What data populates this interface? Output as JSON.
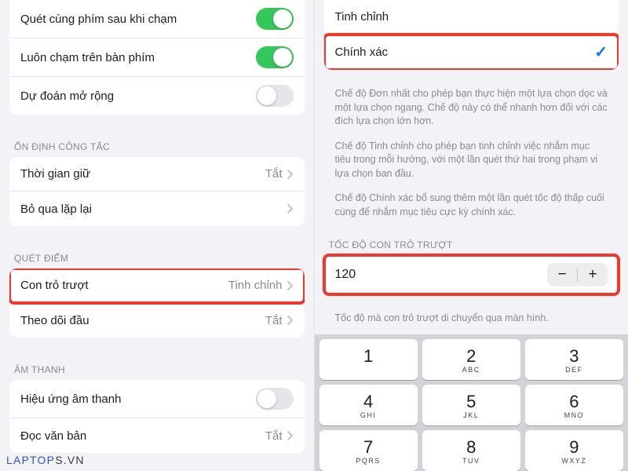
{
  "left": {
    "topRows": [
      {
        "label": "Quét cùng phím sau khi chạm",
        "toggle": true
      },
      {
        "label": "Luôn chạm trên bàn phím",
        "toggle": true
      },
      {
        "label": "Dự đoán mở rộng",
        "toggle": false
      }
    ],
    "groups": [
      {
        "header": "ỔN ĐỊNH CÔNG TẮC",
        "rows": [
          {
            "label": "Thời gian giữ",
            "value": "Tắt"
          },
          {
            "label": "Bỏ qua lặp lại",
            "value": ""
          }
        ]
      },
      {
        "header": "QUÉT ĐIỂM",
        "rows": [
          {
            "label": "Con trỏ trượt",
            "value": "Tinh chỉnh",
            "highlight": true
          },
          {
            "label": "Theo dõi đầu",
            "value": "Tắt"
          }
        ]
      },
      {
        "header": "ÂM THANH",
        "rows": [
          {
            "label": "Hiệu ứng âm thanh",
            "toggle": false
          },
          {
            "label": "Đọc văn bản",
            "value": "Tắt"
          }
        ]
      }
    ]
  },
  "right": {
    "modes": [
      {
        "label": "Tinh chỉnh",
        "checked": false
      },
      {
        "label": "Chính xác",
        "checked": true,
        "highlight": true
      }
    ],
    "notes": [
      "Chế độ Đơn nhất cho phép bạn thực hiện một lựa chọn dọc và một lựa chọn ngang. Chế độ này có thể nhanh hơn đối với các đích lựa chọn lớn hơn.",
      "Chế độ Tinh chỉnh cho phép bạn tinh chỉnh việc nhắm mục tiêu trong mỗi hướng, với một lần quét thứ hai trong phạm vi lựa chọn ban đầu.",
      "Chế độ Chính xác bổ sung thêm một lần quét tốc độ thấp cuối cùng để nhắm mục tiêu cực kỳ chính xác."
    ],
    "speed": {
      "header": "TỐC ĐỘ CON TRỎ TRƯỢT",
      "value": "120",
      "note": "Tốc độ mà con trỏ trượt di chuyển qua màn hình."
    },
    "keypad": [
      {
        "num": "1",
        "sub": ""
      },
      {
        "num": "2",
        "sub": "ABC"
      },
      {
        "num": "3",
        "sub": "DEF"
      },
      {
        "num": "4",
        "sub": "GHI"
      },
      {
        "num": "5",
        "sub": "JKL"
      },
      {
        "num": "6",
        "sub": "MNO"
      },
      {
        "num": "7",
        "sub": "PQRS"
      },
      {
        "num": "8",
        "sub": "TUV"
      },
      {
        "num": "9",
        "sub": "WXYZ"
      }
    ]
  },
  "watermark": {
    "a": "LAPTOP",
    "b": "S.VN"
  }
}
